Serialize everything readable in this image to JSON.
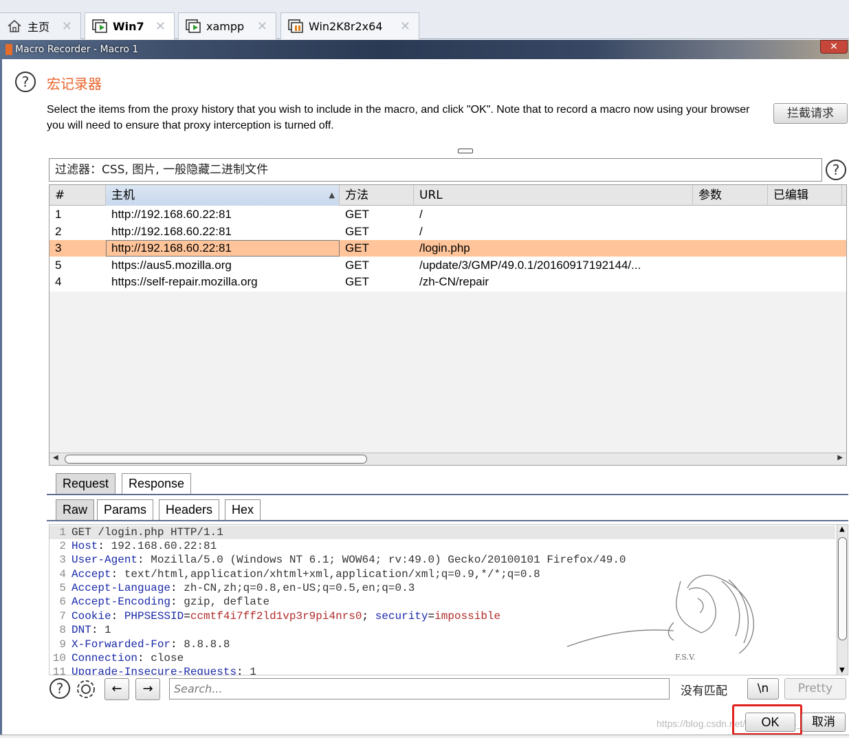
{
  "vm_tabs": [
    {
      "label": "主页",
      "icon": "home-icon"
    },
    {
      "label": "Win7",
      "icon": "vm-running-icon"
    },
    {
      "label": "xampp",
      "icon": "vm-running-icon"
    },
    {
      "label": "Win2K8r2x64",
      "icon": "vm-paused-icon"
    }
  ],
  "window": {
    "title": "Macro Recorder - Macro 1",
    "close_label": "✕"
  },
  "header": {
    "heading": "宏记录器",
    "description": "Select the items from the proxy history that you wish to include in the macro, and click \"OK\". Note that to record a macro now using your browser you will need to ensure that proxy interception is turned off.",
    "intercept_button": "拦截请求"
  },
  "filter": {
    "text": "过滤器：CSS, 图片, 一般隐藏二进制文件"
  },
  "table": {
    "columns": [
      "#",
      "主机",
      "方法",
      "URL",
      "参数",
      "已编辑"
    ],
    "rows": [
      {
        "num": "1",
        "host": "http://192.168.60.22:81",
        "method": "GET",
        "url": "/"
      },
      {
        "num": "2",
        "host": "http://192.168.60.22:81",
        "method": "GET",
        "url": "/"
      },
      {
        "num": "3",
        "host": "http://192.168.60.22:81",
        "method": "GET",
        "url": "/login.php"
      },
      {
        "num": "5",
        "host": "https://aus5.mozilla.org",
        "method": "GET",
        "url": "/update/3/GMP/49.0.1/20160917192144/..."
      },
      {
        "num": "4",
        "host": "https://self-repair.mozilla.org",
        "method": "GET",
        "url": "/zh-CN/repair"
      }
    ],
    "selected_row": "3"
  },
  "tabs_main": [
    "Request",
    "Response"
  ],
  "tabs_sub": [
    "Raw",
    "Params",
    "Headers",
    "Hex"
  ],
  "request_lines": [
    {
      "n": "1",
      "key": "GET /login.php HTTP/1.1",
      "sep": "",
      "val": ""
    },
    {
      "n": "2",
      "key": "Host",
      "sep": ": ",
      "val": "192.168.60.22:81"
    },
    {
      "n": "3",
      "key": "User-Agent",
      "sep": ": ",
      "val": "Mozilla/5.0 (Windows NT 6.1; WOW64; rv:49.0) Gecko/20100101 Firefox/49.0"
    },
    {
      "n": "4",
      "key": "Accept",
      "sep": ": ",
      "val": "text/html,application/xhtml+xml,application/xml;q=0.9,*/*;q=0.8"
    },
    {
      "n": "5",
      "key": "Accept-Language",
      "sep": ": ",
      "val": "zh-CN,zh;q=0.8,en-US;q=0.5,en;q=0.3"
    },
    {
      "n": "6",
      "key": "Accept-Encoding",
      "sep": ": ",
      "val": "gzip, deflate"
    },
    {
      "n": "7",
      "key": "Cookie",
      "sep": ": ",
      "val": ""
    },
    {
      "n": "8",
      "key": "DNT",
      "sep": ": ",
      "val": "1"
    },
    {
      "n": "9",
      "key": "X-Forwarded-For",
      "sep": ": ",
      "val": "8.8.8.8"
    },
    {
      "n": "10",
      "key": "Connection",
      "sep": ": ",
      "val": "close"
    },
    {
      "n": "11",
      "key": "Upgrade-Insecure-Requests",
      "sep": ": ",
      "val": "1"
    }
  ],
  "cookie": {
    "name1": "PHPSESSID",
    "eq": "=",
    "val1": "ccmtf4i7ff2ld1vp3r9pi4nrs0",
    "sep": "; ",
    "name2": "security",
    "val2": "impossible"
  },
  "watermark_text": "F.S.V.",
  "search": {
    "placeholder": "Search...",
    "no_match": "没有匹配",
    "newline_btn": "\\n",
    "pretty_btn": "Pretty"
  },
  "footer": {
    "ok": "OK",
    "cancel": "取消",
    "credit": "https://blog.csdn.net/Wu_m_n_G_sihuinte"
  },
  "colors": {
    "accent_heading": "#e8632b",
    "selected_row": "#ffc499",
    "highlight_box": "#e0201b"
  }
}
